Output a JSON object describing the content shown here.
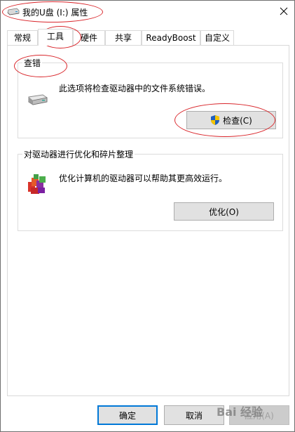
{
  "window": {
    "title": "我的U盘 (I:) 属性"
  },
  "tabs": [
    {
      "label": "常规"
    },
    {
      "label": "工具"
    },
    {
      "label": "硬件"
    },
    {
      "label": "共享"
    },
    {
      "label": "ReadyBoost"
    },
    {
      "label": "自定义"
    }
  ],
  "active_tab": "工具",
  "check_group": {
    "title": "查错",
    "description": "此选项将检查驱动器中的文件系统错误。",
    "button_label": "检查(C)"
  },
  "optimize_group": {
    "title": "对驱动器进行优化和碎片整理",
    "description": "优化计算机的驱动器可以帮助其更高效运行。",
    "button_label": "优化(O)"
  },
  "footer": {
    "ok_label": "确定",
    "cancel_label": "取消",
    "apply_label": "应用(A)"
  },
  "watermark": {
    "text": "Bai 经验"
  },
  "colors": {
    "annotation": "#d9262b",
    "focus_border": "#0078d7",
    "shield_blue": "#1e5fbf",
    "shield_yellow": "#f5c400"
  }
}
